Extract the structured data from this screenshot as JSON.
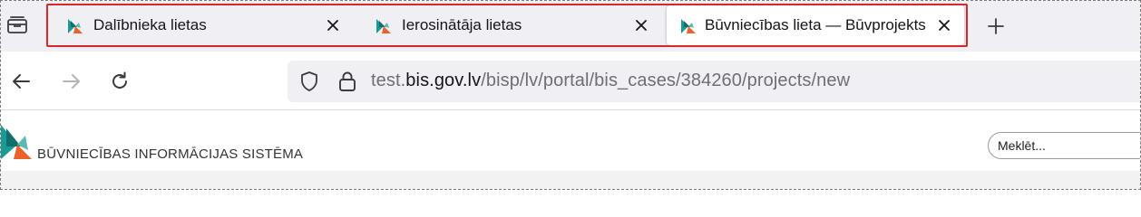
{
  "browser": {
    "tabs": [
      {
        "title": "Dalībnieka lietas",
        "active": false
      },
      {
        "title": "Ierosinātāja lietas",
        "active": false
      },
      {
        "title": "Būvniecības lieta — Būvprojekts",
        "active": true
      }
    ],
    "url": {
      "prefix": "test.",
      "domain": "bis.gov.lv",
      "path": "/bisp/lv/portal/bis_cases/384260/projects/new"
    },
    "colors": {
      "highlight": "#d8282c",
      "favicon_teal": "#1a9a95",
      "favicon_orange": "#e8622a"
    }
  },
  "page": {
    "site_title": "BŪVNIECĪBAS INFORMĀCIJAS SISTĒMA",
    "search_placeholder": "Meklēt..."
  }
}
